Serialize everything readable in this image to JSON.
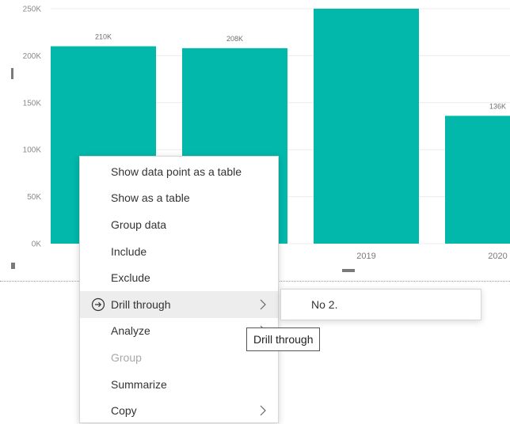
{
  "chart_data": {
    "type": "bar",
    "categories": [
      "",
      "",
      "2019",
      "2020"
    ],
    "values": [
      210000,
      208000,
      250000,
      136000
    ],
    "data_labels": [
      "210K",
      "208K",
      "",
      "136K"
    ],
    "y_ticks": [
      "0K",
      "50K",
      "100K",
      "150K",
      "200K",
      "250K"
    ],
    "ylim": [
      0,
      250000
    ],
    "bar_color": "#01B8AA",
    "grid": true,
    "legend": "none"
  },
  "context_menu": {
    "items": [
      {
        "label": "Show data point as a table",
        "enabled": true,
        "submenu": false
      },
      {
        "label": "Show as a table",
        "enabled": true,
        "submenu": false
      },
      {
        "label": "Group data",
        "enabled": true,
        "submenu": false
      },
      {
        "label": "Include",
        "enabled": true,
        "submenu": false
      },
      {
        "label": "Exclude",
        "enabled": true,
        "submenu": false
      },
      {
        "label": "Drill through",
        "enabled": true,
        "submenu": true,
        "icon": "drill-through-icon",
        "hovered": true
      },
      {
        "label": "Analyze",
        "enabled": true,
        "submenu": true
      },
      {
        "label": "Group",
        "enabled": false,
        "submenu": false
      },
      {
        "label": "Summarize",
        "enabled": true,
        "submenu": false
      },
      {
        "label": "Copy",
        "enabled": true,
        "submenu": true
      }
    ]
  },
  "submenu": {
    "items": [
      {
        "label": "No 2."
      }
    ]
  },
  "tooltip": {
    "text": "Drill through"
  }
}
